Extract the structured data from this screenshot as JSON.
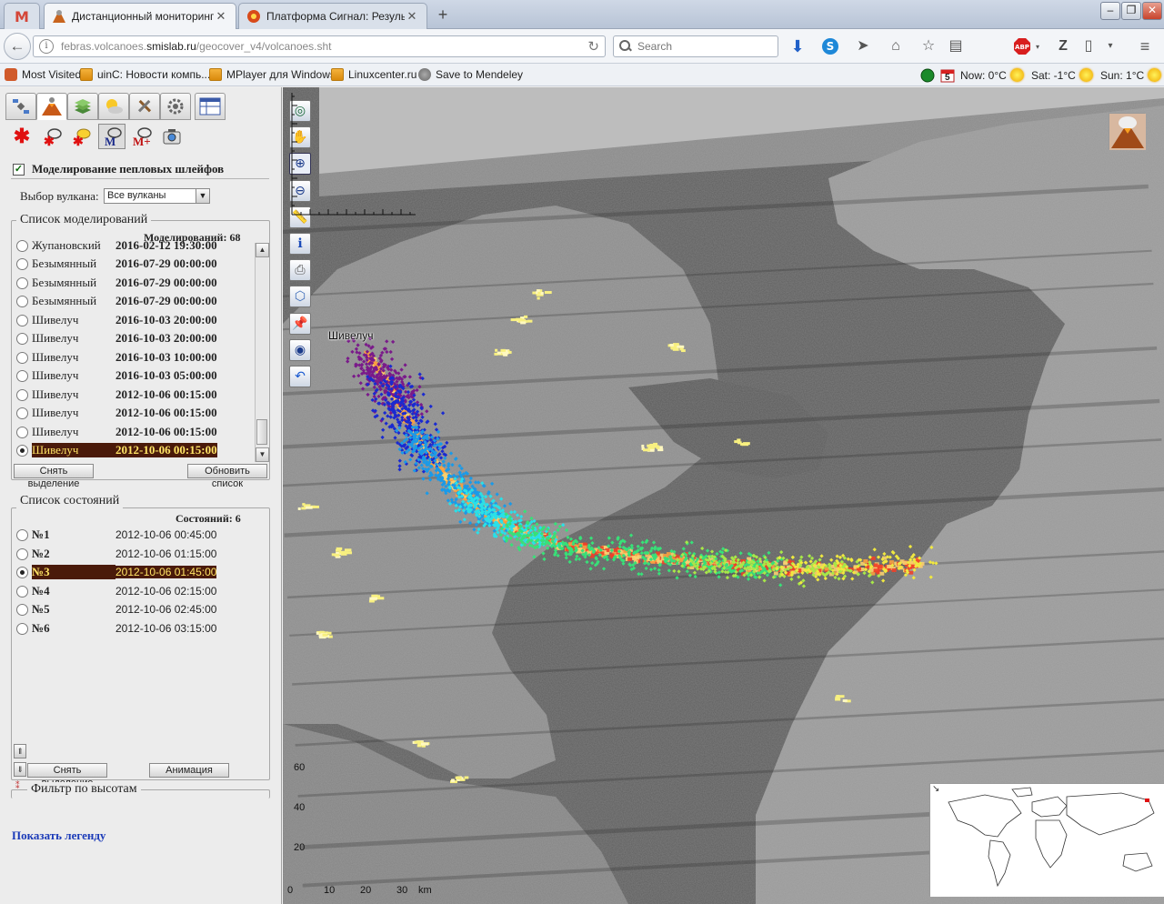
{
  "browser": {
    "tabs": [
      {
        "label": "Дистанционный мониторинг ..."
      },
      {
        "label": "Платформа Сигнал: Резуль..."
      }
    ],
    "url_host": "febras.volcanoes.",
    "url_domain": "smislab.ru",
    "url_path": "/geocover_v4/volcanoes.sht",
    "search_placeholder": "Search",
    "bookmarks": [
      {
        "label": "Most Visited",
        "icon": "most-visited-icon"
      },
      {
        "label": "uinC: Новости компь...",
        "icon": "rss-icon"
      },
      {
        "label": "MPlayer для Windows",
        "icon": "rss-icon"
      },
      {
        "label": "Linuxcenter.ru",
        "icon": "rss-icon"
      },
      {
        "label": "Save to Mendeley",
        "icon": "mendeley-icon"
      }
    ],
    "weather": {
      "calendar_day": "5",
      "now": "Now: 0°C",
      "sat": "Sat: -1°C",
      "sun": "Sun: 1°C"
    }
  },
  "panel": {
    "plume_checkbox_label": "Моделирование пепловых шлейфов",
    "volcano_select_label": "Выбор вулкана:",
    "volcano_select_value": "Все вулканы",
    "models_legend": "Список моделирований",
    "models_count": "Моделирований: 68",
    "models": [
      {
        "name": "Жупановский",
        "date": "2016-02-12 19:30:00"
      },
      {
        "name": "Безымянный",
        "date": "2016-07-29 00:00:00"
      },
      {
        "name": "Безымянный",
        "date": "2016-07-29 00:00:00"
      },
      {
        "name": "Безымянный",
        "date": "2016-07-29 00:00:00"
      },
      {
        "name": "Шивелуч",
        "date": "2016-10-03 20:00:00"
      },
      {
        "name": "Шивелуч",
        "date": "2016-10-03 20:00:00"
      },
      {
        "name": "Шивелуч",
        "date": "2016-10-03 10:00:00"
      },
      {
        "name": "Шивелуч",
        "date": "2016-10-03 05:00:00"
      },
      {
        "name": "Шивелуч",
        "date": "2012-10-06 00:15:00"
      },
      {
        "name": "Шивелуч",
        "date": "2012-10-06 00:15:00"
      },
      {
        "name": "Шивелуч",
        "date": "2012-10-06 00:15:00"
      },
      {
        "name": "Шивелуч",
        "date": "2012-10-06 00:15:00"
      }
    ],
    "models_selected_index": 11,
    "clear_selection_label": "Снять выделение",
    "refresh_list_label": "Обновить список",
    "states_legend": "Список состояний",
    "states_count": "Состояний: 6",
    "states": [
      {
        "name": "№1",
        "date": "2012-10-06 00:45:00"
      },
      {
        "name": "№2",
        "date": "2012-10-06 01:15:00"
      },
      {
        "name": "№3",
        "date": "2012-10-06 01:45:00"
      },
      {
        "name": "№4",
        "date": "2012-10-06 02:15:00"
      },
      {
        "name": "№5",
        "date": "2012-10-06 02:45:00"
      },
      {
        "name": "№6",
        "date": "2012-10-06 03:15:00"
      }
    ],
    "states_selected_index": 2,
    "states_clear_label": "Снять выделение",
    "animation_label": "Анимация",
    "height_filter_label": "Фильтр по высотам",
    "show_legend_label": "Показать легенду"
  },
  "map": {
    "volcano_label": "Шивелуч",
    "scale_labels": [
      "60",
      "40",
      "20"
    ],
    "scale_x_labels": [
      "0",
      "10",
      "20",
      "30"
    ],
    "scale_unit": "km",
    "tools": [
      "overview-icon",
      "pan-icon",
      "zoom-in-icon",
      "zoom-out-icon",
      "ruler-icon",
      "info-icon",
      "print-icon",
      "draw-area-icon",
      "pin-icon",
      "globe-icon",
      "undo-icon"
    ],
    "colors": {
      "violet": "#7a1a8a",
      "blue": "#1a2ad0",
      "sky": "#1a9ae8",
      "cyan": "#2ae0e8",
      "green": "#38e078",
      "lime": "#a8e848",
      "yellow": "#f0e840",
      "plume_core": "#f04028",
      "plume_orange": "#f8a040",
      "plume_yellow": "#f8d070"
    }
  }
}
